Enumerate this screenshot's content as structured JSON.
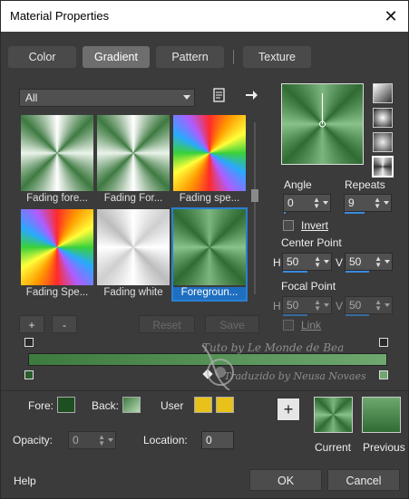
{
  "window": {
    "title": "Material Properties",
    "close_glyph": "✕"
  },
  "tabs": [
    {
      "label": "Color",
      "active": false
    },
    {
      "label": "Gradient",
      "active": true
    },
    {
      "label": "Pattern",
      "active": false
    },
    {
      "label": "Texture",
      "active": false
    }
  ],
  "filter": {
    "selected": "All",
    "icon_new": "new-document-icon",
    "icon_more": "arrow-right-icon"
  },
  "gallery": [
    {
      "label": "Fading fore...",
      "style": "fade"
    },
    {
      "label": "Fading For...",
      "style": "fade"
    },
    {
      "label": "Fading spe...",
      "style": "spec"
    },
    {
      "label": "Fading Spe...",
      "style": "spec"
    },
    {
      "label": "Fading white",
      "style": "white"
    },
    {
      "label": "Foregroun...",
      "style": "green",
      "selected": true
    }
  ],
  "gallery_buttons": {
    "add": "+",
    "remove": "-",
    "reset": "Reset",
    "save": "Save"
  },
  "angle": {
    "label": "Angle",
    "value": "0",
    "level": 0
  },
  "repeats": {
    "label": "Repeats",
    "value": "9",
    "level": 0.09
  },
  "invert": {
    "label": "Invert",
    "checked": false
  },
  "center_point": {
    "label": "Center Point",
    "h_label": "H",
    "h_value": "50",
    "v_label": "V",
    "v_value": "50"
  },
  "focal_point": {
    "label": "Focal Point",
    "h_label": "H",
    "h_value": "50",
    "v_label": "V",
    "v_value": "50"
  },
  "link": {
    "label": "Link",
    "checked": false
  },
  "bottom": {
    "fore_label": "Fore:",
    "back_label": "Back:",
    "user_label": "User",
    "opacity_label": "Opacity:",
    "opacity_value": "0",
    "location_label": "Location:",
    "location_value": "0",
    "add_glyph": "+",
    "current_label": "Current",
    "previous_label": "Previous"
  },
  "watermark": {
    "line1": "Tuto by Le Monde de Bea",
    "line2": "Traduzido by Neusa Novaes"
  },
  "footer": {
    "help": "Help",
    "ok": "OK",
    "cancel": "Cancel"
  },
  "colors": {
    "accent": "#1f6fc0",
    "gradient_start": "#3d7a3e",
    "gradient_end": "#6ea86f",
    "user_swatch": "#e8c21a"
  }
}
